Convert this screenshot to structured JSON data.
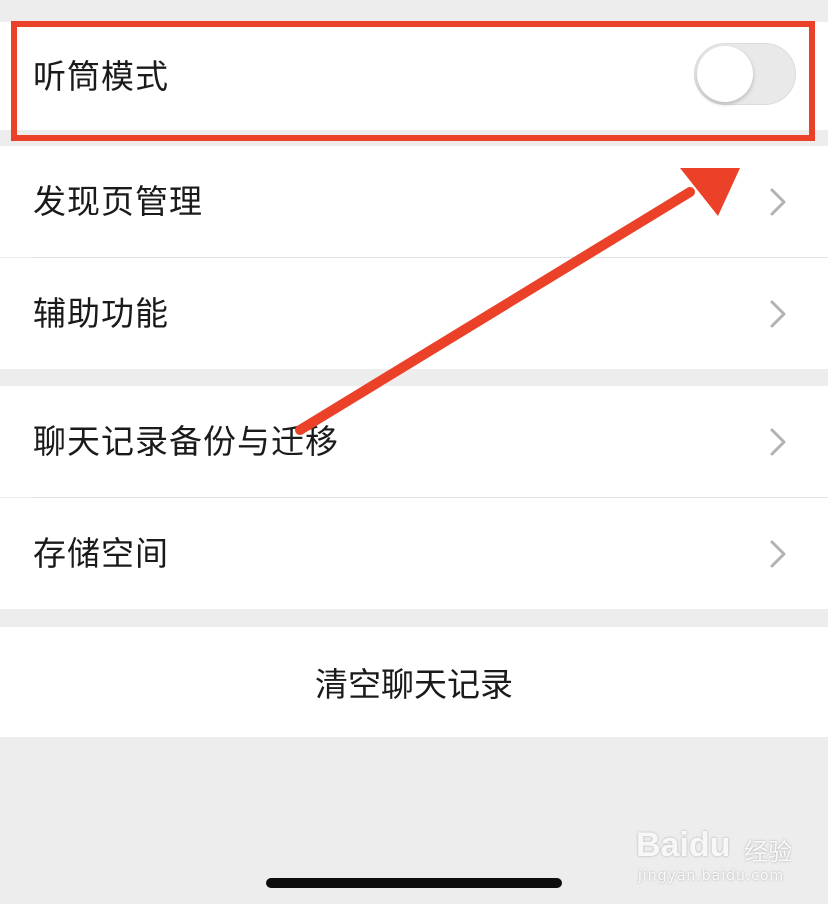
{
  "settings": {
    "earpiece_mode": {
      "label": "听筒模式",
      "enabled": false
    },
    "group1": [
      {
        "label": "发现页管理"
      },
      {
        "label": "辅助功能"
      }
    ],
    "group2": [
      {
        "label": "聊天记录备份与迁移"
      },
      {
        "label": "存储空间"
      }
    ],
    "clear_chat": {
      "label": "清空聊天记录"
    }
  },
  "annotation": {
    "color": "#ea4128"
  },
  "watermark": {
    "brand": "Baidu",
    "sub": "经验",
    "url": "jingyan.baidu.com"
  }
}
